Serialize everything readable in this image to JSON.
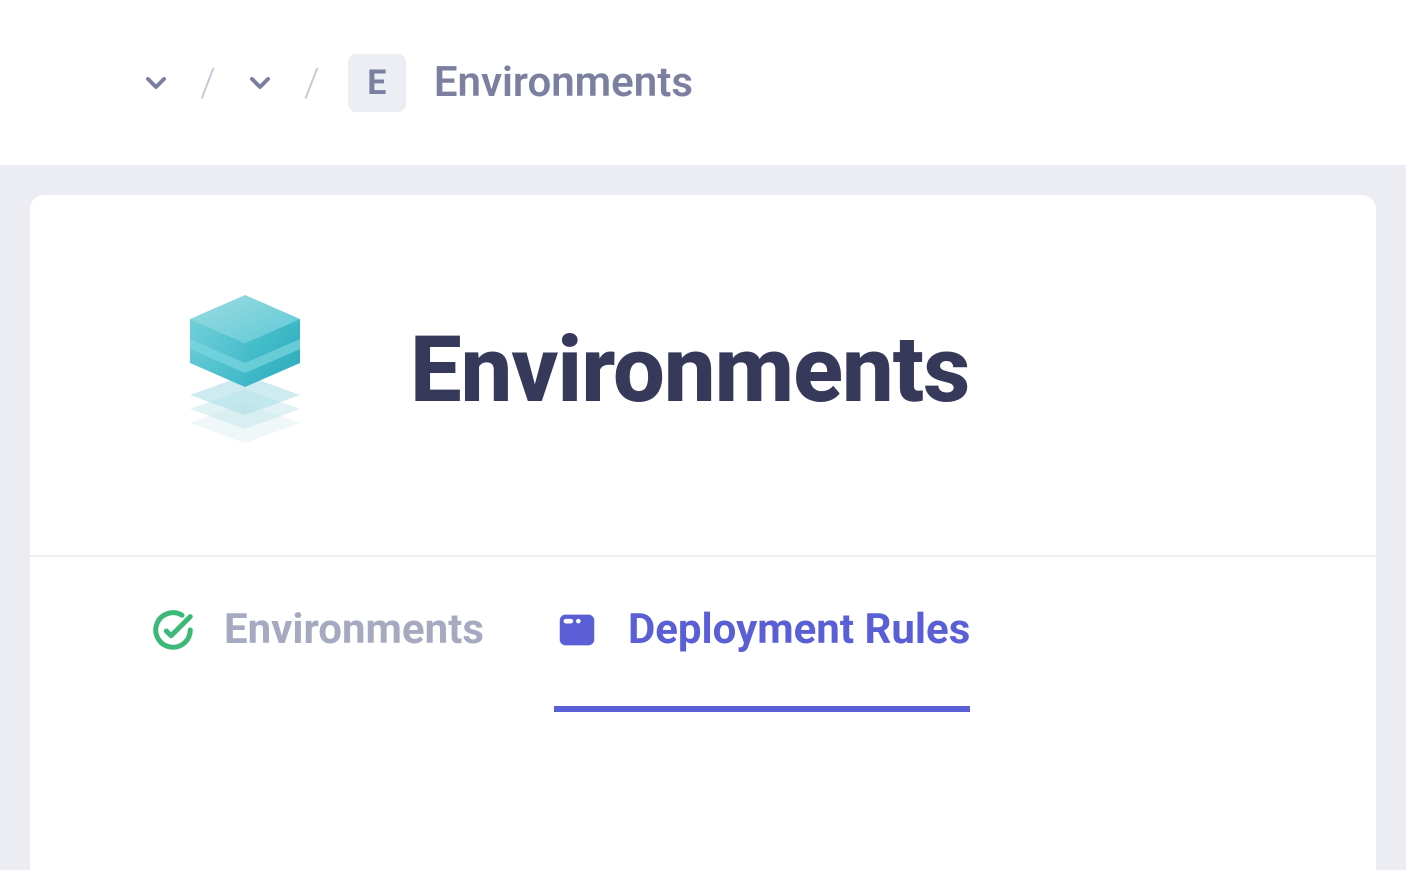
{
  "breadcrumb": {
    "badge_letter": "E",
    "current_label": "Environments"
  },
  "header": {
    "title": "Environments"
  },
  "tabs": [
    {
      "label": "Environments",
      "active": false,
      "icon": "check-circle-icon"
    },
    {
      "label": "Deployment Rules",
      "active": true,
      "icon": "card-icon"
    }
  ],
  "colors": {
    "accent": "#5b5fd6",
    "success": "#3cb878",
    "muted": "#a5aac0",
    "text_dark": "#36395a",
    "breadcrumb_text": "#7b80a0",
    "page_bg": "#ecedf2"
  }
}
